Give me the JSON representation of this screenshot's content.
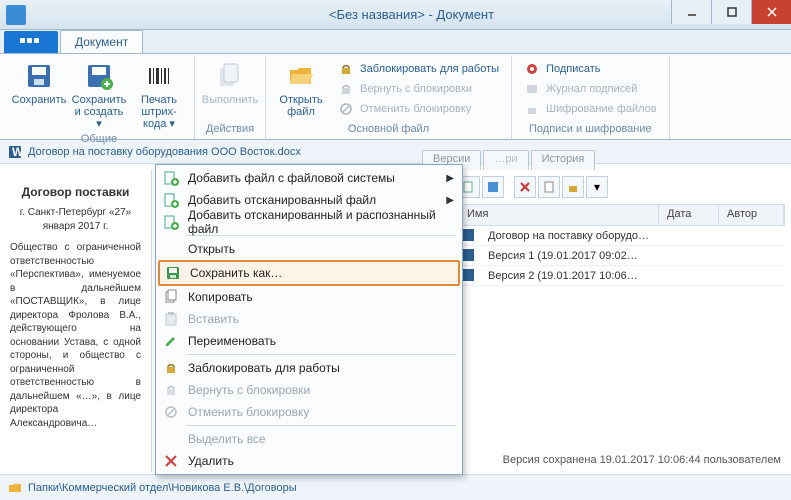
{
  "window": {
    "title": "<Без названия> - Документ"
  },
  "ribbon": {
    "tab_label": "Документ",
    "groups": {
      "common": {
        "label": "Общие",
        "save": "Сохранить",
        "save_and_create": "Сохранить и создать ▾",
        "barcode": "Печать штрих-кода ▾"
      },
      "actions": {
        "label": "Действия",
        "execute": "Выполнить"
      },
      "main_file": {
        "label": "Основной файл",
        "open": "Открыть файл",
        "lock": "Заблокировать для работы",
        "unlock": "Вернуть с блокировки",
        "cancel_lock": "Отменить блокировку"
      },
      "sign": {
        "label": "Подписи и шифрование",
        "sign": "Подписать",
        "journal": "Журнал подписей",
        "encrypt": "Шифрование файлов"
      }
    }
  },
  "docbar": {
    "name": "Договор на поставку оборудования ООО Восток.docx"
  },
  "tabs": {
    "versions": "Версии",
    "history": "История"
  },
  "list": {
    "columns": {
      "name": "Имя",
      "date": "Дата",
      "author": "Автор"
    },
    "rows": [
      {
        "name": "Договор на поставку оборудо…"
      },
      {
        "name": "Версия 1 (19.01.2017 09:02…"
      },
      {
        "name": "Версия 2 (19.01.2017 10:06…"
      }
    ]
  },
  "preview": {
    "title": "Договор поставки",
    "city_line": "г. Санкт-Петербург «27» января 2017 г.",
    "body": "Общество с ограниченной ответственностью «Перспектива», именуемое в дальнейшем «ПОСТАВЩИК», в лице директора Фролова В.А., действующего на основании Устава, с одной стороны, и общество с ограниченной ответственностью в дальнейшем «…», в лице директора Александровича…"
  },
  "footnote": "Версия сохранена 19.01.2017 10:06:44 пользователем",
  "statusbar": {
    "path": "Папки\\Коммерческий отдел\\Новикова Е.В.\\Договоры"
  },
  "context_menu": {
    "add_file": "Добавить файл с файловой системы",
    "add_scan": "Добавить отсканированный файл",
    "add_scan_ocr": "Добавить отсканированный и распознанный файл",
    "open": "Открыть",
    "save_as": "Сохранить как…",
    "copy": "Копировать",
    "paste": "Вставить",
    "rename": "Переименовать",
    "lock": "Заблокировать для работы",
    "unlock": "Вернуть с блокировки",
    "cancel_lock": "Отменить блокировку",
    "select_all": "Выделить все",
    "delete": "Удалить"
  }
}
